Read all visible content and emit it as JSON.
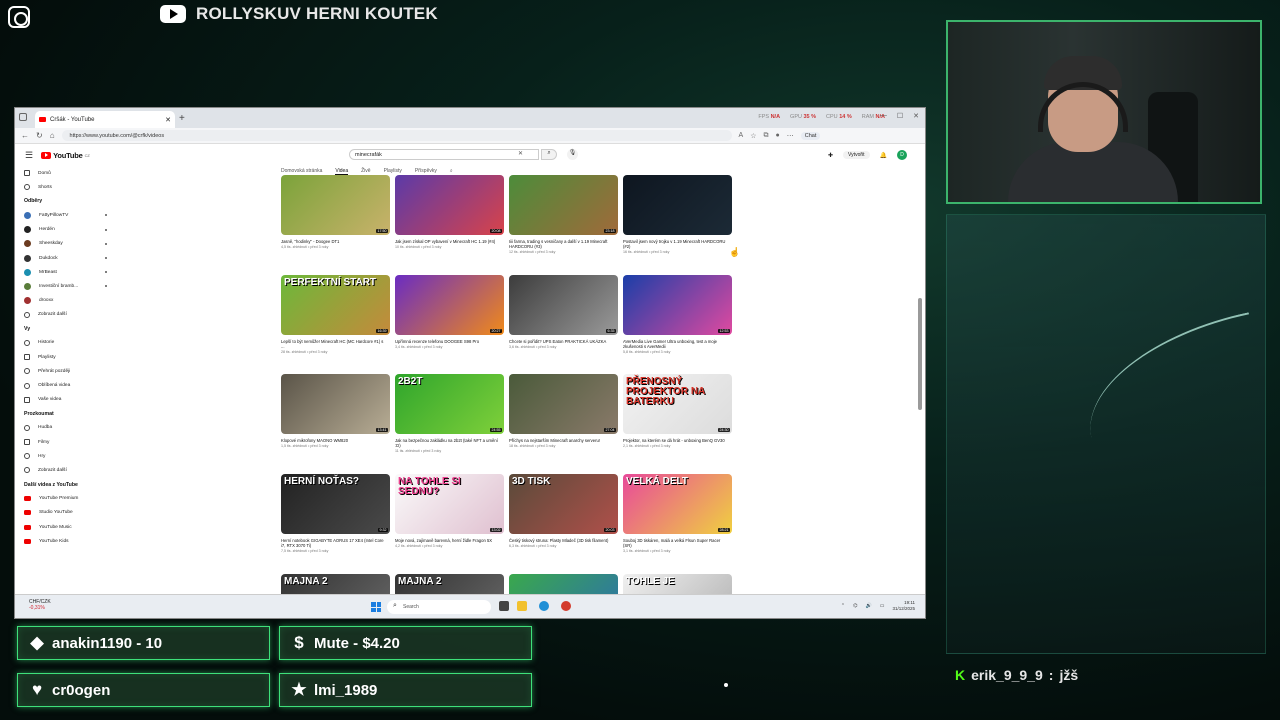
{
  "overlay": {
    "channel_title": "ROLLYSKUV HERNI KOUTEK",
    "alerts": [
      {
        "icon": "diamond-icon",
        "text": "anakin1190 - 10"
      },
      {
        "icon": "dollar-icon",
        "text": "Mute - $4.20"
      },
      {
        "icon": "heart-icon",
        "text": "cr0ogen"
      },
      {
        "icon": "star-icon",
        "text": "lmi_1989"
      }
    ],
    "chat": {
      "platform_icon": "kick-icon",
      "user": "erik_9_9_9",
      "sep": ":",
      "message": "jžš"
    }
  },
  "browser": {
    "tab_title": "Cršák - YouTube",
    "url": "https://www.youtube.com/@crfk/videos",
    "chat_button": "Chat",
    "stats": {
      "fps_label": "FPS",
      "fps_value": "N/A",
      "gpu_label": "GPU",
      "gpu_value": "35 %",
      "cpu_label": "CPU",
      "cpu_value": "14 %",
      "ram_label": "RAM",
      "ram_value": "N/A"
    }
  },
  "youtube": {
    "logo_text": "YouTube",
    "logo_region": "CZ",
    "search_value": "minecrafák",
    "create_label": "Vytvořit",
    "avatar_letter": "D",
    "channel_tabs": [
      "Domovská stránka",
      "Videa",
      "Živě",
      "Playlisty",
      "Příspěvky"
    ],
    "sidebar": {
      "main": [
        {
          "label": "Domů"
        },
        {
          "label": "Shorts"
        }
      ],
      "subs_title": "Odběry",
      "subs": [
        {
          "label": "FattyPillowTV",
          "color": "#3a6fb5"
        },
        {
          "label": "Herdén",
          "color": "#222222"
        },
        {
          "label": "Sheeskday",
          "color": "#6b3b1f"
        },
        {
          "label": "Dukdock",
          "color": "#333333"
        },
        {
          "label": "MrBeast",
          "color": "#1b8fb0"
        },
        {
          "label": "Investiční bramb...",
          "color": "#5a7d3a"
        },
        {
          "label": "drooxx",
          "color": "#a03030"
        },
        {
          "label": "Zobrazit další",
          "color": ""
        }
      ],
      "you_title": "Vy",
      "you": [
        {
          "label": "Historie"
        },
        {
          "label": "Playlisty"
        },
        {
          "label": "Přehrát později"
        },
        {
          "label": "Oblíbená videa"
        },
        {
          "label": "Vaše videa"
        }
      ],
      "explore_title": "Prozkoumat",
      "explore": [
        {
          "label": "Hudba"
        },
        {
          "label": "Filmy"
        },
        {
          "label": "Hry"
        },
        {
          "label": "Zobrazit další"
        }
      ],
      "more_title": "Další videa z YouTube",
      "more": [
        {
          "label": "YouTube Premium"
        },
        {
          "label": "Studio YouTube"
        },
        {
          "label": "YouTube Music"
        },
        {
          "label": "YouTube Kids"
        }
      ]
    },
    "videos": [
      {
        "title": "Jasně, \"hodinky\" - Doogee DT1",
        "meta": "4,5 tis. zhlédnutí • před 3 roky",
        "duration": "17:50",
        "overlay": "",
        "bg": "linear-gradient(135deg,#7ba33a,#c9b26b)"
      },
      {
        "title": "Jak jsem získal OP vybavení v Minecraft HC 1.19 (#4)",
        "meta": "10 tis. zhlédnutí • před 3 roky",
        "duration": "20:08",
        "overlay": "",
        "bg": "linear-gradient(135deg,#5b3aa8,#d8434a)"
      },
      {
        "title": "Iiii farma, trading s vesničany a další v 1.19 Minecraft HARDCORU (#3)",
        "meta": "12 tis. zhlédnutí • před 3 roky",
        "duration": "23:18",
        "overlay": "",
        "bg": "linear-gradient(135deg,#4c8c3a,#a06a3a)"
      },
      {
        "title": "Postavil jsem nový trojku v 1.19 Minecraft HARDCORU (#2)",
        "meta": "16 tis. zhlédnutí • před 3 roky",
        "duration": "",
        "overlay": "",
        "bg": "linear-gradient(135deg,#0e1620,#1c2a36)"
      },
      {
        "title": "Lepší to být nemůže! Minecraft HC (MC Hardcore #1) s ...",
        "meta": "28 tis. zhlédnutí • před 3 roky",
        "duration": "16:39",
        "overlay": "PERFEKTNÍ START",
        "bg": "linear-gradient(135deg,#6cb83a,#c58a3b)"
      },
      {
        "title": "Upřímná recenze telefonu DOOGEE S98 Pro",
        "meta": "3,4 tis. zhlédnutí • před 3 roky",
        "duration": "20:27",
        "overlay": "",
        "bg": "linear-gradient(135deg,#6a2cc2,#f08a1a)"
      },
      {
        "title": "Chcete si pořídit? UPS Eaton PRAKTICKÁ UKÁZKA",
        "meta": "3,6 tis. zhlédnutí • před 3 roky",
        "duration": "6:35",
        "overlay": "",
        "bg": "linear-gradient(135deg,#3c3c3c,#9a9a9a)"
      },
      {
        "title": "AVerMedia Live Gamer Ultra unboxing, test a moje zkušenosti s AverMedii",
        "meta": "5,8 tis. zhlédnutí • před 3 roky",
        "duration": "12:53",
        "overlay": "",
        "bg": "linear-gradient(135deg,#1a3ea8,#e04aa0)"
      },
      {
        "title": "Klopové mikrofony MAONO WM820",
        "meta": "1,5 tis. zhlédnutí • před 3 roky",
        "duration": "13:41",
        "overlay": "",
        "bg": "linear-gradient(135deg,#5a5448,#b8ad95)"
      },
      {
        "title": "Jak na bezpečnou zakládku na 2b2t (také NFT a umění :D)",
        "meta": "11 tis. zhlédnutí • před 3 roky",
        "duration": "24:55",
        "overlay": "2B2T",
        "bg": "linear-gradient(135deg,#2fa52c,#7fd03a)"
      },
      {
        "title": "Příchys na nejstarším Minecraft anarchy serveru!",
        "meta": "18 tis. zhlédnutí • před 3 roky",
        "duration": "27:04",
        "overlay": "",
        "bg": "linear-gradient(135deg,#4a5a3a,#8a7a6a)"
      },
      {
        "title": "Projektor, na kterém se dá hrát - unboxing BenQ GV30",
        "meta": "2,1 tis. zhlédnutí • před 3 roky",
        "duration": "24:30",
        "overlay": "PŘENOSNÝ PROJEKTOR NA BATERKU",
        "bg": "linear-gradient(135deg,#f2f2f2,#dcdcdc)"
      },
      {
        "title": "Herní notebook GIGABYTE AORUS 17 XE4 (Intel Core i7, RTX 3070 Ti)",
        "meta": "7,5 tis. zhlédnutí • před 3 roky",
        "duration": "9:32",
        "overlay": "HERNÍ NOŤAS?",
        "bg": "linear-gradient(135deg,#222,#4a4a4a)"
      },
      {
        "title": "Moje nová, zajímavě barevná, herní židle Fragon 5X",
        "meta": "4,2 tis. zhlédnutí • před 3 roky",
        "duration": "13:02",
        "overlay": "NA TOHLE SI SEDNU?",
        "bg": "linear-gradient(135deg,#fafafa,#e0c0d0)"
      },
      {
        "title": "Český tiskový struna: Plasty Mladeč (3D tisk filament)",
        "meta": "6,3 tis. zhlédnutí • před 3 roky",
        "duration": "20:03",
        "overlay": "3D TISK",
        "bg": "linear-gradient(135deg,#5a4a3a,#b0504a)"
      },
      {
        "title": "Souboj 3D tiskáren, malá a velká Flsun Super Racer (SR)",
        "meta": "3,1 tis. zhlédnutí • před 3 roky",
        "duration": "28:21",
        "overlay": "VELKÁ DELT",
        "bg": "linear-gradient(135deg,#e84a9a,#f0d040)"
      },
      {
        "title": "",
        "meta": "",
        "duration": "",
        "overlay": "MAJNA 2",
        "bg": "linear-gradient(135deg,#333,#6a6a6a)"
      },
      {
        "title": "",
        "meta": "",
        "duration": "",
        "overlay": "MAJNA 2",
        "bg": "linear-gradient(135deg,#333,#6a6a6a)"
      },
      {
        "title": "",
        "meta": "",
        "duration": "",
        "overlay": "",
        "bg": "linear-gradient(135deg,#3aa84c,#2c6fb0)"
      },
      {
        "title": "",
        "meta": "",
        "duration": "",
        "overlay": "TOHLE JE",
        "bg": "linear-gradient(135deg,#f0f0f0,#b0b0b0)"
      }
    ]
  },
  "taskbar": {
    "weather_title": "CHF/CZK",
    "weather_sub": "-0,31%",
    "search_placeholder": "Search",
    "time": "19:11",
    "date": "31/12/2025"
  }
}
